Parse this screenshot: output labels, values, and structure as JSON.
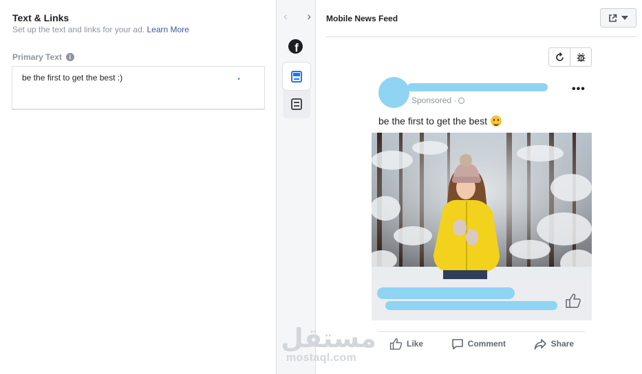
{
  "left_panel": {
    "title": "Text & Links",
    "subtitle": "Set up the text and links for your ad.",
    "learn_more": "Learn More",
    "primary_text_label": "Primary Text",
    "info_glyph": "i",
    "primary_text_value": "be the first to get the best :)"
  },
  "rail": {
    "prev_arrow": "‹",
    "next_arrow": "›",
    "facebook_glyph": "f"
  },
  "preview": {
    "title": "Mobile News Feed",
    "post": {
      "sponsored": "Sponsored ·",
      "more_glyph": "•••",
      "text": "be the first to get the best"
    },
    "actions": {
      "like": "Like",
      "comment": "Comment",
      "share": "Share"
    }
  },
  "watermark": {
    "arabic": "مستقل",
    "latin": "mostaql.com"
  }
}
